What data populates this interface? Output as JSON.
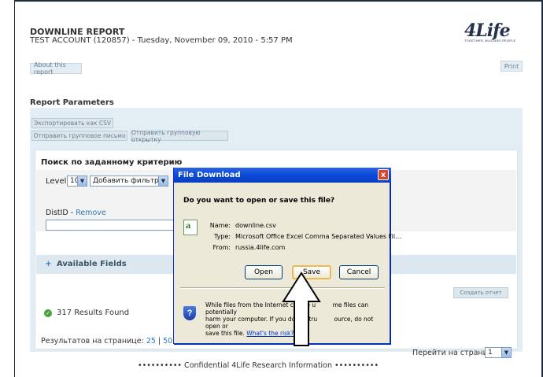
{
  "report": {
    "title": "DOWNLINE REPORT",
    "subtitle": "TEST ACCOUNT (120857) - Tuesday, November 09, 2010 - 5:57 PM",
    "about_label": "About this report",
    "print_label": "Print"
  },
  "logo": {
    "text": "4Life",
    "tagline": "TOGETHER, BUILDING PEOPLE"
  },
  "params": {
    "title": "Report Parameters",
    "export_csv": "Экспортировать как CSV",
    "send_group_email": "Отправить групповое письмо",
    "send_group_card": "Отправить групповую открытку",
    "search_heading": "Поиск по заданному критерию",
    "level_label": "Level",
    "level_value": "10",
    "add_filters": "Добавить фильтры",
    "distid_label": "DistID",
    "distid_sep": " - ",
    "remove_label": "Remove",
    "available_fields": "Available Fields",
    "create_report": "Создать отчет"
  },
  "results": {
    "count_text": "317 Results Found",
    "per_page_label": "Результатов на странице:",
    "per_page_options": [
      "25",
      "50",
      "100"
    ],
    "goto_label": "Перейти на страницу:",
    "goto_value": "1",
    "confidential": "•••••••••• Confidential 4Life Research Information ••••••••••"
  },
  "dialog": {
    "title": "File Download",
    "close_glyph": "x",
    "question": "Do you want to open or save this file?",
    "name_label": "Name:",
    "name_value": "downline.csv",
    "type_label": "Type:",
    "type_value": "Microsoft Office Excel Comma Separated Values Fil...",
    "from_label": "From:",
    "from_value": "russia.4life.com",
    "open_label": "Open",
    "save_label": "Save",
    "cancel_label": "Cancel",
    "warning_text_1": "While files from the Internet can be u",
    "warning_text_2": "me files can potentially",
    "warning_text_3": "harm your computer. If you do not tru",
    "warning_text_4": "ource, do not open or",
    "warning_text_5": "save this file.",
    "risk_link": "What's the risk?"
  },
  "colors": {
    "accent": "#2a7ab5",
    "title_bar": "#0a4ad8",
    "panel": "#e3eef4"
  }
}
